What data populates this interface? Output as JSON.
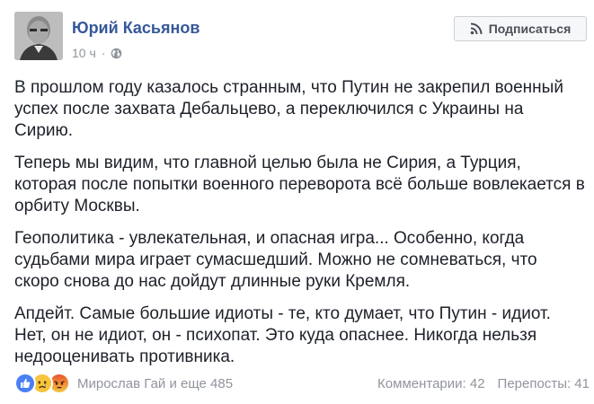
{
  "author": {
    "name": "Юрий Касьянов"
  },
  "meta": {
    "time": "10 ч",
    "separator": "·",
    "privacy_icon": "globe-icon"
  },
  "subscribe": {
    "label": "Подписаться",
    "icon": "rss-icon"
  },
  "post": {
    "paragraphs": [
      "В прошлом году казалось странным, что Путин не закрепил военный успех после захвата Дебальцево, а переключился с Украины на Сирию.",
      "Теперь мы видим, что главной целью была не Сирия, а Турция, которая после попытки военного переворота всё больше вовлекается в орбиту Москвы.",
      "Геополитика - увлекательная, и опасная игра... Особенно, когда судьбами мира играет сумасшедший. Можно не сомневаться, что скоро снова до нас дойдут длинные руки Кремля.",
      "Апдейт. Самые большие идиоты - те, кто думает, что Путин - идиот. Нет, он не идиот, он - психопат. Это куда опаснее. Никогда нельзя недооценивать противника."
    ]
  },
  "footer": {
    "reactions": [
      "like-icon",
      "sad-icon",
      "angry-icon"
    ],
    "reactors_text": "Мирослав Гай и еще 485",
    "comments": "Комментарии: 42",
    "shares": "Перепосты: 41"
  },
  "colors": {
    "link": "#365899",
    "muted": "#90949c",
    "text": "#1d2129",
    "like": "#4a7ff5",
    "sad": "#f7c43d",
    "angry": "#e9552e"
  }
}
